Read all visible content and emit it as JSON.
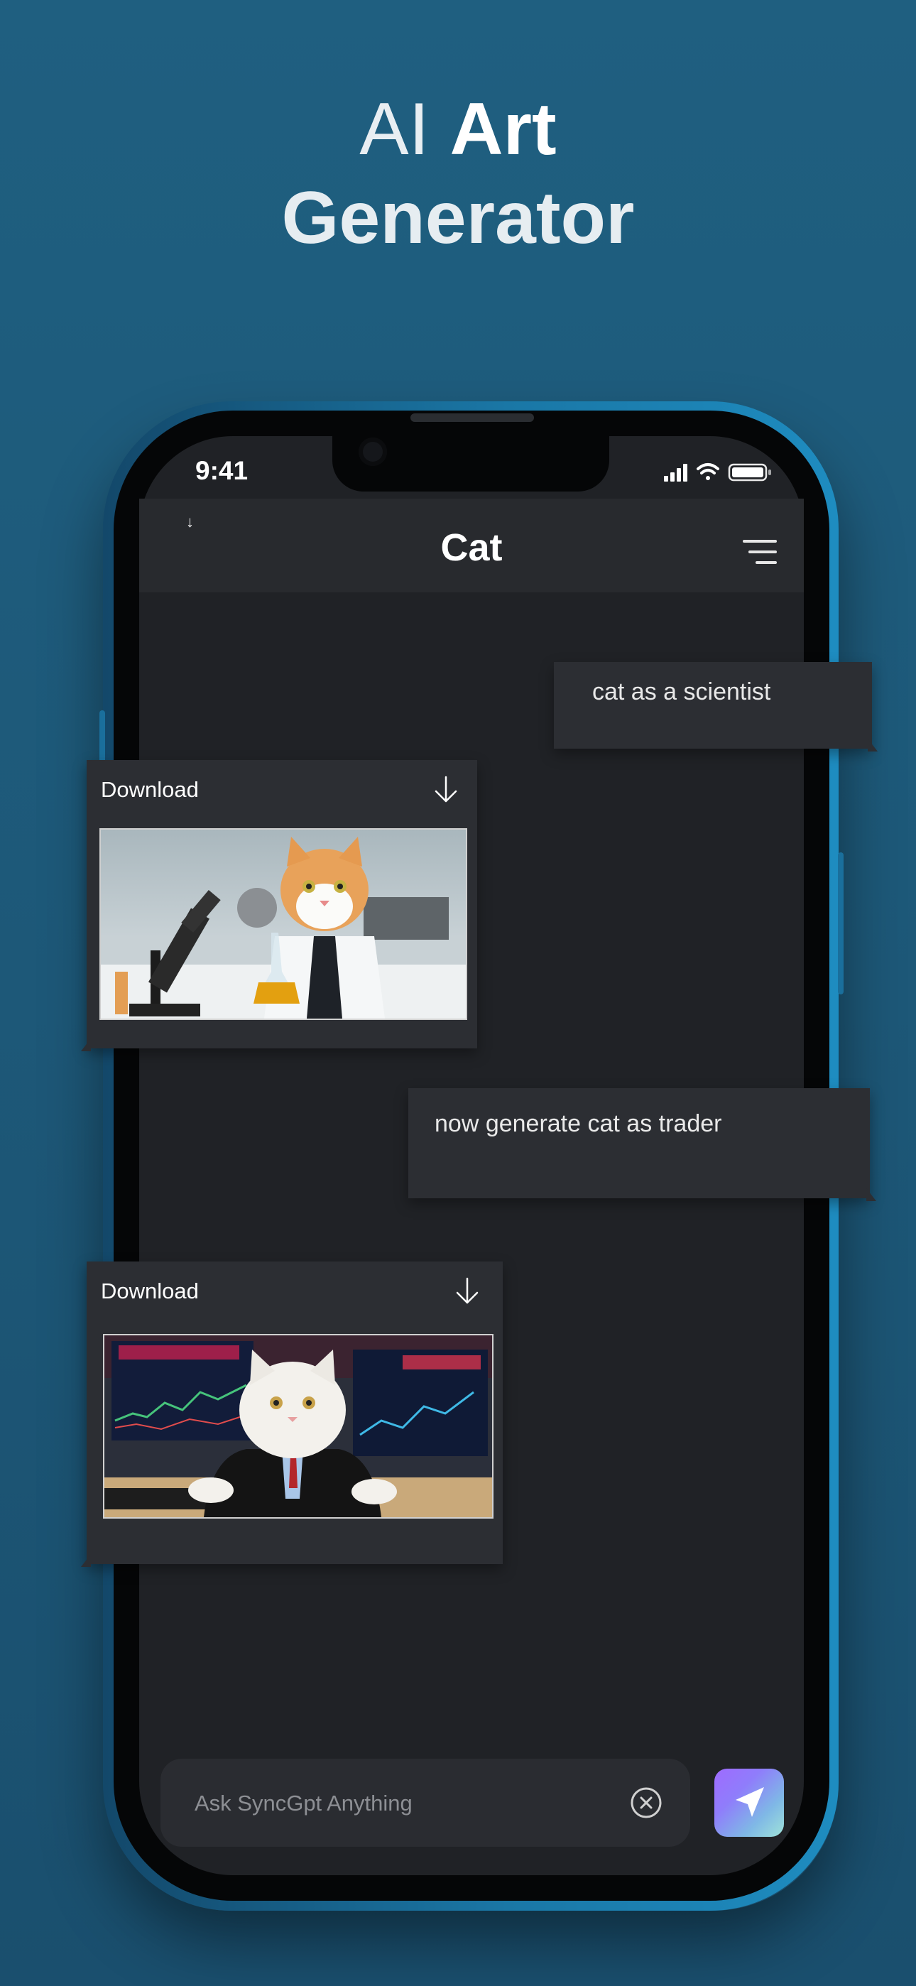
{
  "headline": {
    "line1_regular": "AI",
    "line1_bold": "Art",
    "line2": "Generator"
  },
  "status_bar": {
    "time": "9:41",
    "icons": [
      "signal-icon",
      "wifi-icon",
      "battery-icon"
    ]
  },
  "appbar": {
    "title": "Cat",
    "back_icon": "down-arrow-icon",
    "menu_icon": "menu-icon"
  },
  "messages": [
    {
      "role": "user",
      "text": "cat as a scientist"
    },
    {
      "role": "assistant",
      "download_label": "Download",
      "image": "cat-scientist-image"
    },
    {
      "role": "user",
      "text": "now generate cat as trader"
    },
    {
      "role": "assistant",
      "download_label": "Download",
      "image": "cat-trader-image"
    }
  ],
  "composer": {
    "placeholder": "Ask SyncGpt Anything",
    "value": "",
    "clear_icon": "close-circle-icon",
    "send_icon": "send-icon"
  },
  "colors": {
    "background": "#1d5878",
    "screen": "#202226",
    "appbar": "#282a2e",
    "bubble": "#2c2e33",
    "send_gradient_start": "#9f6bff",
    "send_gradient_end": "#9fe3d9"
  }
}
